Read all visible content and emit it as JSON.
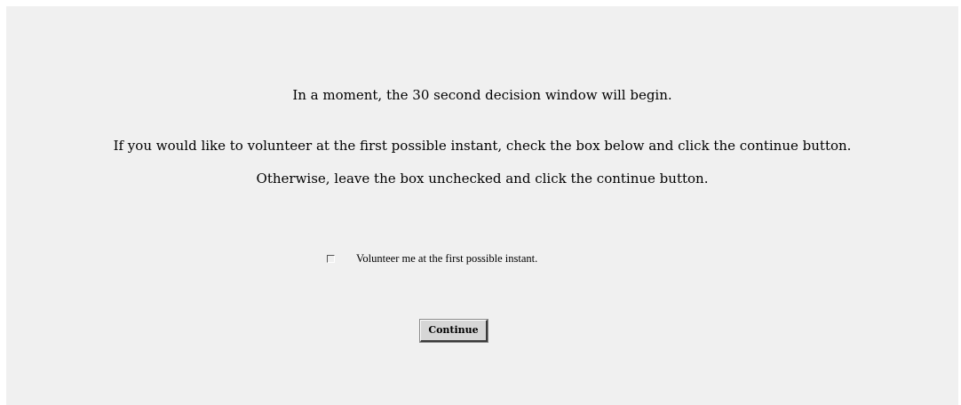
{
  "instructions": {
    "line1": "In a moment, the 30 second decision window will begin.",
    "line2": "If you would like to volunteer at the first possible instant, check the box below and click the continue button.",
    "line3": "Otherwise, leave the box  unchecked and click the continue button."
  },
  "volunteer_checkbox": {
    "label": "Volunteer me at the first possible instant.",
    "checked": false
  },
  "continue_button": {
    "label": "Continue"
  }
}
